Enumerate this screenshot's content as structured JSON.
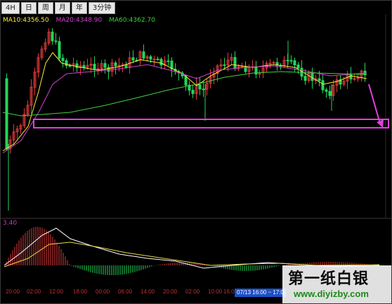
{
  "toolbar": {
    "tabs": [
      {
        "label": "4H"
      },
      {
        "label": "日"
      },
      {
        "label": "周"
      },
      {
        "label": "月"
      },
      {
        "label": "年"
      },
      {
        "label": "3分钟"
      }
    ]
  },
  "ma_legend": [
    {
      "text": "MA10:4356.50",
      "color": "#ffeb3b"
    },
    {
      "text": "MA20:4348.90",
      "color": "#d040d0"
    },
    {
      "text": "MA60:4362.70",
      "color": "#3fd23f"
    }
  ],
  "indicator": {
    "label": "3.40"
  },
  "time_axis": [
    "20:00",
    "02:00",
    "12:00",
    "18:00",
    "00:00",
    "06:00",
    "14:00",
    "20:00",
    "02:00",
    "10:00",
    "16:00"
  ],
  "tooltip": "07/13 16:00 ~ 17:0",
  "watermark": {
    "title": "第一纸白银",
    "url": "www.diyizby.com"
  },
  "colors": {
    "up": "#e23a3a",
    "down": "#22d65a",
    "ma10": "#ffeb3b",
    "ma20": "#d040d0",
    "ma60": "#3fd23f",
    "annotation": "#e040e0"
  }
}
